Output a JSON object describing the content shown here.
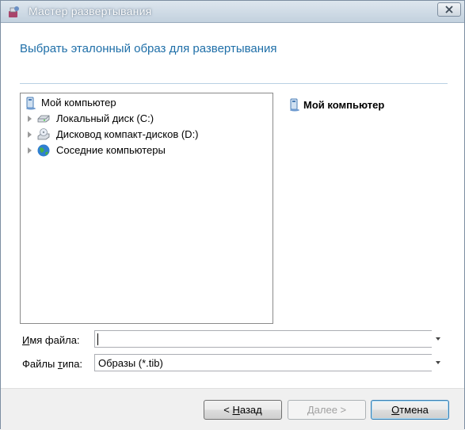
{
  "window": {
    "title": "Мастер развертывания",
    "close_glyph": "×"
  },
  "header": {
    "heading": "Выбрать эталонный образ для развертывания"
  },
  "tree": {
    "root": {
      "label": "Мой компьютер",
      "icon": "computer-icon"
    },
    "items": [
      {
        "label": "Локальный диск (C:)",
        "icon": "hard-drive-icon"
      },
      {
        "label": "Дисковод компакт-дисков (D:)",
        "icon": "cd-drive-icon"
      },
      {
        "label": "Соседние компьютеры",
        "icon": "network-globe-icon"
      }
    ]
  },
  "info": {
    "title": "Мой компьютер"
  },
  "form": {
    "filename_label_pre": "",
    "filename_label_ul": "И",
    "filename_label_post": "мя файла:",
    "filename_value": "",
    "filetype_label_pre": "Файлы ",
    "filetype_label_ul": "т",
    "filetype_label_post": "ипа:",
    "filetype_value": "Образы (*.tib)"
  },
  "buttons": {
    "back_ul": "Н",
    "back_rest": "азад",
    "back_prefix": "< ",
    "next_label": "Далее >",
    "cancel_ul": "О",
    "cancel_rest": "тмена"
  },
  "colors": {
    "heading": "#1f6fa8",
    "title_text": "#ffffff"
  }
}
